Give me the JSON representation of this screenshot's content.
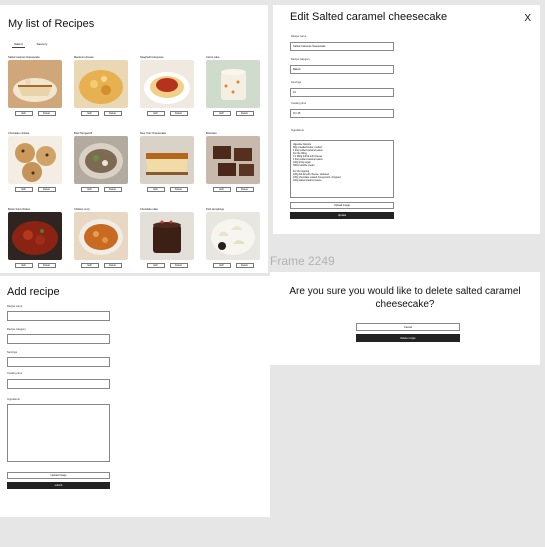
{
  "list": {
    "title": "My list of Recipes",
    "tabs": [
      "Salted",
      "Savoury"
    ],
    "recipes": [
      {
        "name": "Salted caramel cheesecake",
        "edit": "Edit",
        "delete": "Delete"
      },
      {
        "name": "Macaroni cheese",
        "edit": "Edit",
        "delete": "Delete"
      },
      {
        "name": "Spaghetti bolognese",
        "edit": "Edit",
        "delete": "Delete"
      },
      {
        "name": "Carrot cake",
        "edit": "Edit",
        "delete": "Delete"
      },
      {
        "name": "Chocolate cookies",
        "edit": "Edit",
        "delete": "Delete"
      },
      {
        "name": "Beef Stroganoff",
        "edit": "Edit",
        "delete": "Delete"
      },
      {
        "name": "New York Cheesecake",
        "edit": "Edit",
        "delete": "Delete"
      },
      {
        "name": "Brownies",
        "edit": "Edit",
        "delete": "Delete"
      },
      {
        "name": "Butter fried chicken",
        "edit": "Edit",
        "delete": "Delete"
      },
      {
        "name": "Chicken curry",
        "edit": "Edit",
        "delete": "Delete"
      },
      {
        "name": "Chocolate cake",
        "edit": "Edit",
        "delete": "Delete"
      },
      {
        "name": "Pork dumplings",
        "edit": "Edit",
        "delete": "Delete"
      }
    ]
  },
  "add": {
    "title": "Add recipe",
    "labels": [
      "Recipe name",
      "Recipe category",
      "Servings",
      "Cooking time",
      "Ingredients"
    ],
    "upload": "Upload image",
    "submit": "submit"
  },
  "edit": {
    "title": "Edit Salted caramel cheesecake",
    "close": "X",
    "labels": {
      "name": "Recipe name",
      "category": "Recipe category",
      "servings": "Servings",
      "cooking": "Cooking time",
      "ingredients": "Ingredients"
    },
    "values": {
      "name": "Salted Caramel cheesecake",
      "category": "Baked",
      "servings": "10",
      "cooking": "1hr 45"
    },
    "ingredients_text": "digestive biscuits\n60g unsalted butter, melted\n1 tbsp salted caramel sauce\nFor the filling\n3 x 280g full fat soft cheese\n1 tbsp salted caramel sauce\n100g icing sugar\n300ml double cream\n\nFor the topping\n100g full-fat soft cheese, softened\n100g chocolate coated honeycomb, chopped\n100g salted caramel sauce",
    "upload": "Upload image",
    "update": "Update"
  },
  "frame_label": "Frame 2249",
  "delete": {
    "question": "Are you sure you would like to delete salted caramel cheesecake?",
    "cancel": "Cancel",
    "confirm": "Delete recipe"
  }
}
